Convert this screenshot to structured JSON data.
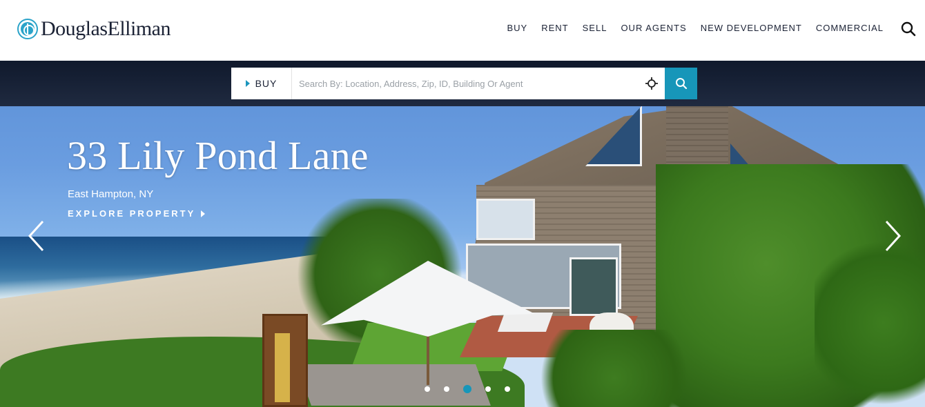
{
  "header": {
    "logo_text": "DouglasElliman",
    "nav": [
      {
        "label": "BUY"
      },
      {
        "label": "RENT"
      },
      {
        "label": "SELL"
      },
      {
        "label": "OUR AGENTS"
      },
      {
        "label": "NEW DEVELOPMENT"
      },
      {
        "label": "COMMERCIAL"
      }
    ],
    "search_icon": "search-icon"
  },
  "search": {
    "type_label": "BUY",
    "placeholder": "Search By: Location, Address, Zip, ID, Building Or Agent",
    "value": "",
    "locate_icon": "crosshair-icon",
    "submit_icon": "search-icon",
    "accent_color": "#1796b9"
  },
  "hero": {
    "title": "33 Lily Pond Lane",
    "location": "East Hampton, NY",
    "cta": "EXPLORE PROPERTY",
    "prev_icon": "chevron-left-icon",
    "next_icon": "chevron-right-icon",
    "slides_count": 5,
    "active_slide": 3
  },
  "colors": {
    "brand": "#1b2235",
    "accent": "#1796b9",
    "logo": "#2aa3c9"
  }
}
